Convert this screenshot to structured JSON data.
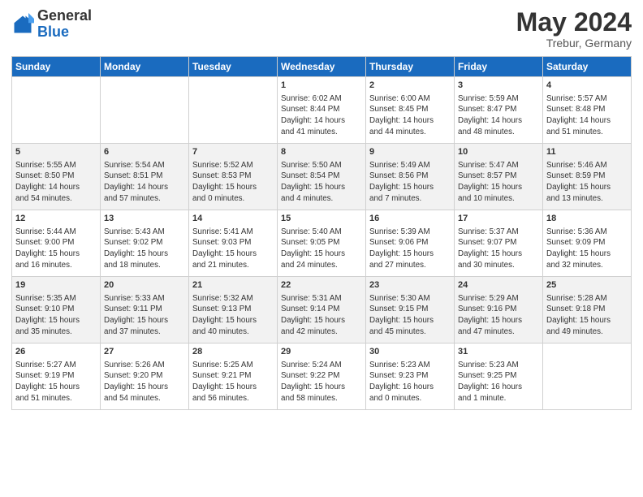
{
  "header": {
    "logo_general": "General",
    "logo_blue": "Blue",
    "month": "May 2024",
    "location": "Trebur, Germany"
  },
  "days_of_week": [
    "Sunday",
    "Monday",
    "Tuesday",
    "Wednesday",
    "Thursday",
    "Friday",
    "Saturday"
  ],
  "weeks": [
    [
      {
        "day": "",
        "info": ""
      },
      {
        "day": "",
        "info": ""
      },
      {
        "day": "",
        "info": ""
      },
      {
        "day": "1",
        "info": "Sunrise: 6:02 AM\nSunset: 8:44 PM\nDaylight: 14 hours\nand 41 minutes."
      },
      {
        "day": "2",
        "info": "Sunrise: 6:00 AM\nSunset: 8:45 PM\nDaylight: 14 hours\nand 44 minutes."
      },
      {
        "day": "3",
        "info": "Sunrise: 5:59 AM\nSunset: 8:47 PM\nDaylight: 14 hours\nand 48 minutes."
      },
      {
        "day": "4",
        "info": "Sunrise: 5:57 AM\nSunset: 8:48 PM\nDaylight: 14 hours\nand 51 minutes."
      }
    ],
    [
      {
        "day": "5",
        "info": "Sunrise: 5:55 AM\nSunset: 8:50 PM\nDaylight: 14 hours\nand 54 minutes."
      },
      {
        "day": "6",
        "info": "Sunrise: 5:54 AM\nSunset: 8:51 PM\nDaylight: 14 hours\nand 57 minutes."
      },
      {
        "day": "7",
        "info": "Sunrise: 5:52 AM\nSunset: 8:53 PM\nDaylight: 15 hours\nand 0 minutes."
      },
      {
        "day": "8",
        "info": "Sunrise: 5:50 AM\nSunset: 8:54 PM\nDaylight: 15 hours\nand 4 minutes."
      },
      {
        "day": "9",
        "info": "Sunrise: 5:49 AM\nSunset: 8:56 PM\nDaylight: 15 hours\nand 7 minutes."
      },
      {
        "day": "10",
        "info": "Sunrise: 5:47 AM\nSunset: 8:57 PM\nDaylight: 15 hours\nand 10 minutes."
      },
      {
        "day": "11",
        "info": "Sunrise: 5:46 AM\nSunset: 8:59 PM\nDaylight: 15 hours\nand 13 minutes."
      }
    ],
    [
      {
        "day": "12",
        "info": "Sunrise: 5:44 AM\nSunset: 9:00 PM\nDaylight: 15 hours\nand 16 minutes."
      },
      {
        "day": "13",
        "info": "Sunrise: 5:43 AM\nSunset: 9:02 PM\nDaylight: 15 hours\nand 18 minutes."
      },
      {
        "day": "14",
        "info": "Sunrise: 5:41 AM\nSunset: 9:03 PM\nDaylight: 15 hours\nand 21 minutes."
      },
      {
        "day": "15",
        "info": "Sunrise: 5:40 AM\nSunset: 9:05 PM\nDaylight: 15 hours\nand 24 minutes."
      },
      {
        "day": "16",
        "info": "Sunrise: 5:39 AM\nSunset: 9:06 PM\nDaylight: 15 hours\nand 27 minutes."
      },
      {
        "day": "17",
        "info": "Sunrise: 5:37 AM\nSunset: 9:07 PM\nDaylight: 15 hours\nand 30 minutes."
      },
      {
        "day": "18",
        "info": "Sunrise: 5:36 AM\nSunset: 9:09 PM\nDaylight: 15 hours\nand 32 minutes."
      }
    ],
    [
      {
        "day": "19",
        "info": "Sunrise: 5:35 AM\nSunset: 9:10 PM\nDaylight: 15 hours\nand 35 minutes."
      },
      {
        "day": "20",
        "info": "Sunrise: 5:33 AM\nSunset: 9:11 PM\nDaylight: 15 hours\nand 37 minutes."
      },
      {
        "day": "21",
        "info": "Sunrise: 5:32 AM\nSunset: 9:13 PM\nDaylight: 15 hours\nand 40 minutes."
      },
      {
        "day": "22",
        "info": "Sunrise: 5:31 AM\nSunset: 9:14 PM\nDaylight: 15 hours\nand 42 minutes."
      },
      {
        "day": "23",
        "info": "Sunrise: 5:30 AM\nSunset: 9:15 PM\nDaylight: 15 hours\nand 45 minutes."
      },
      {
        "day": "24",
        "info": "Sunrise: 5:29 AM\nSunset: 9:16 PM\nDaylight: 15 hours\nand 47 minutes."
      },
      {
        "day": "25",
        "info": "Sunrise: 5:28 AM\nSunset: 9:18 PM\nDaylight: 15 hours\nand 49 minutes."
      }
    ],
    [
      {
        "day": "26",
        "info": "Sunrise: 5:27 AM\nSunset: 9:19 PM\nDaylight: 15 hours\nand 51 minutes."
      },
      {
        "day": "27",
        "info": "Sunrise: 5:26 AM\nSunset: 9:20 PM\nDaylight: 15 hours\nand 54 minutes."
      },
      {
        "day": "28",
        "info": "Sunrise: 5:25 AM\nSunset: 9:21 PM\nDaylight: 15 hours\nand 56 minutes."
      },
      {
        "day": "29",
        "info": "Sunrise: 5:24 AM\nSunset: 9:22 PM\nDaylight: 15 hours\nand 58 minutes."
      },
      {
        "day": "30",
        "info": "Sunrise: 5:23 AM\nSunset: 9:23 PM\nDaylight: 16 hours\nand 0 minutes."
      },
      {
        "day": "31",
        "info": "Sunrise: 5:23 AM\nSunset: 9:25 PM\nDaylight: 16 hours\nand 1 minute."
      },
      {
        "day": "",
        "info": ""
      }
    ]
  ]
}
